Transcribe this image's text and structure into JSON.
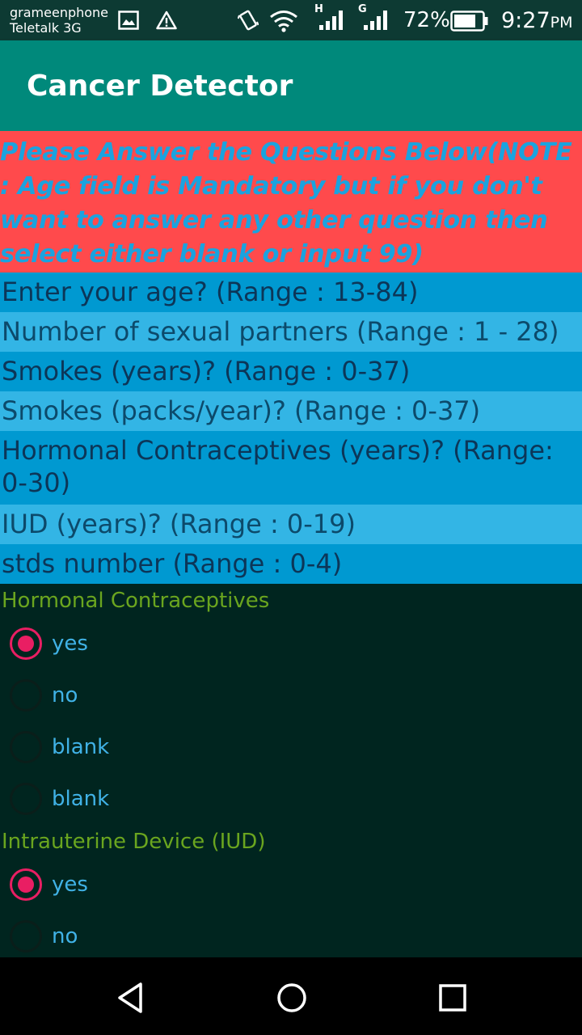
{
  "status_bar": {
    "carrier_1": "grameenphone",
    "carrier_2": "Teletalk 3G",
    "net_1": "H",
    "net_2": "G",
    "battery": "72%",
    "time": "9:27",
    "ampm": "PM"
  },
  "app_bar": {
    "title": "Cancer Detector"
  },
  "notice": "Please Answer the Questions Below(NOTE : Age field is Mandatory but if you don't want to answer any other question then select either blank or input 99)",
  "fields": [
    {
      "hint": "Enter your age? (Range : 13-84)"
    },
    {
      "hint": "Number of sexual partners (Range : 1 - 28)"
    },
    {
      "hint": "Smokes (years)? (Range : 0-37)"
    },
    {
      "hint": "Smokes (packs/year)? (Range : 0-37)"
    },
    {
      "hint": "Hormonal Contraceptives (years)? (Range: 0-30)"
    },
    {
      "hint": "IUD (years)? (Range : 0-19)"
    },
    {
      "hint": "stds number (Range : 0-4)"
    }
  ],
  "groups": [
    {
      "label": "Hormonal Contraceptives",
      "options": [
        "yes",
        "no",
        "blank",
        "blank"
      ],
      "selected": "yes"
    },
    {
      "label": "Intrauterine Device (IUD)",
      "options": [
        "yes",
        "no"
      ],
      "selected": "yes"
    }
  ],
  "colors": {
    "app_bar": "#00897b",
    "notice_bg": "#ff4a4c",
    "notice_text": "#1aa3df",
    "field_dark": "#0099d1",
    "field_light": "#33b5e5",
    "group_label": "#6aa51f",
    "radio_checked": "#e91e63"
  },
  "icons": {
    "status": [
      "image-icon",
      "warning-icon",
      "vibrate-icon",
      "wifi-icon",
      "signal-icon",
      "battery-icon"
    ],
    "nav": [
      "back-icon",
      "home-icon",
      "recents-icon"
    ]
  }
}
